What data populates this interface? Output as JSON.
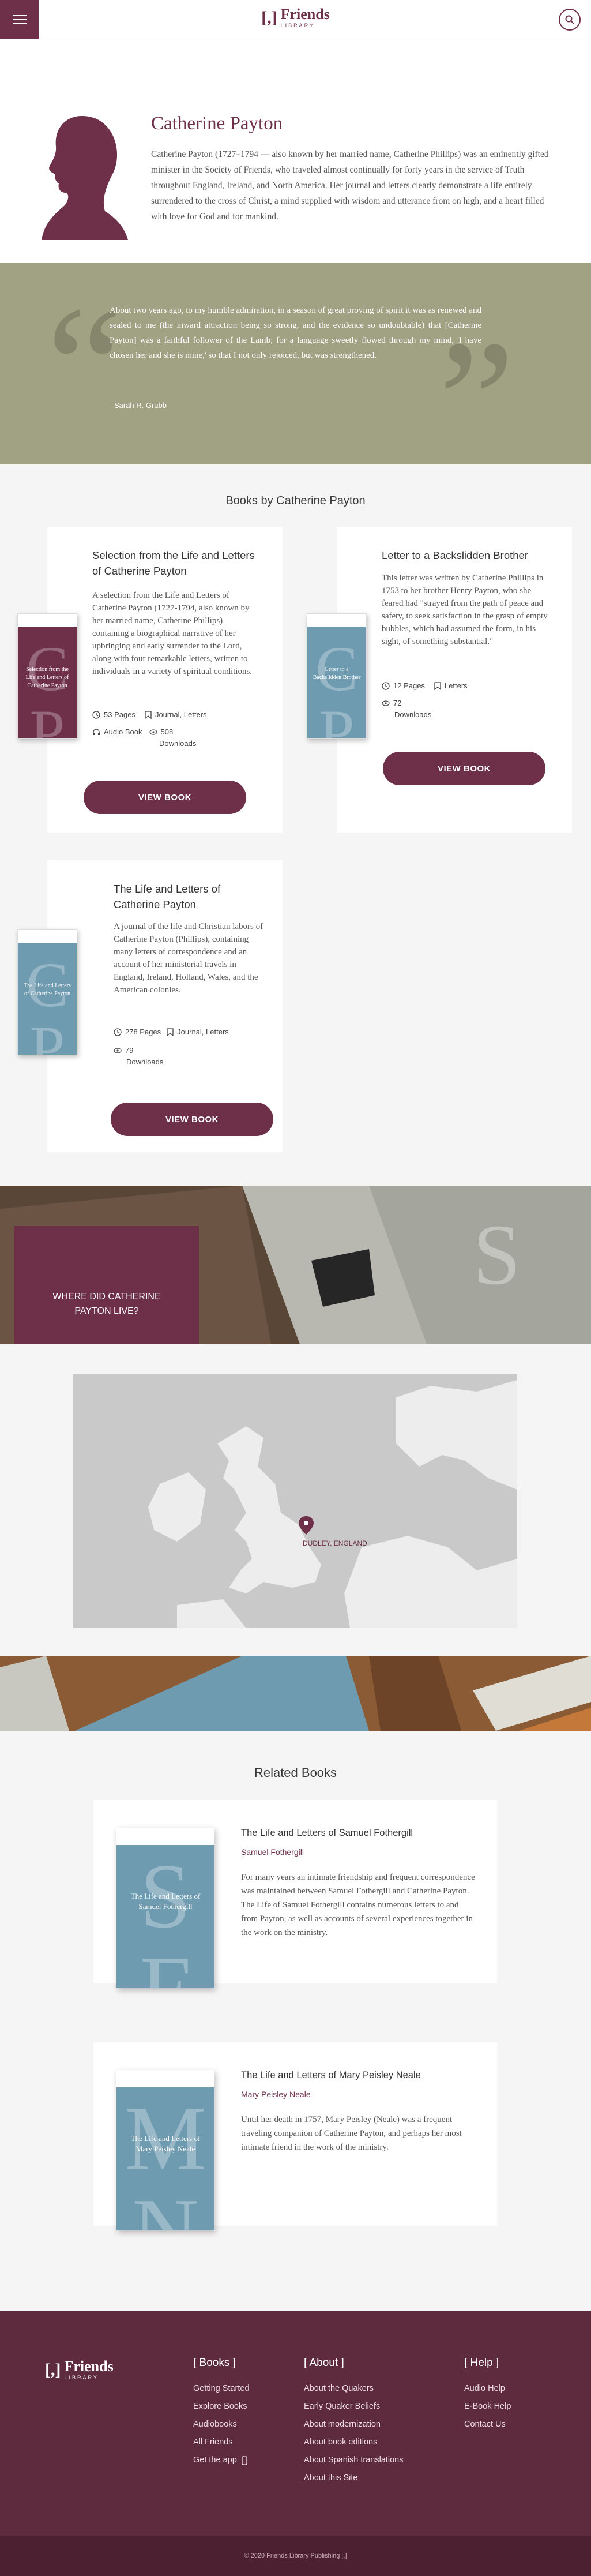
{
  "header": {
    "logo_mark": "[,]",
    "logo_title": "Friends",
    "logo_sub": "LIBRARY"
  },
  "author": {
    "name": "Catherine Payton",
    "bio": "Catherine Payton (1727–1794 — also known by her married name, Catherine Phillips) was an eminently gifted minister in the Society of Friends, who traveled almost continually for forty years in the service of Truth throughout England, Ireland, and North America. Her journal and letters clearly demonstrate a life entirely surrendered to the cross of Christ, a mind supplied with wisdom and utterance from on high, and a heart filled with love for God and for mankind."
  },
  "quote": {
    "text": "About two years ago, to my humble admiration, in a season of great proving of spirit it was as renewed and sealed to me (the inward attraction being so strong, and the evidence so undoubtable) that [Catherine Payton] was a faithful follower of the Lamb; for a language sweetly flowed through my mind, 'I have chosen her and she is mine,' so that I not only rejoiced, but was strengthened.",
    "by": "- Sarah R. Grubb"
  },
  "books_section": {
    "title": "Books by Catherine Payton",
    "view_label": "VIEW BOOK",
    "books": [
      {
        "title": "Selection from the Life and Letters of Catherine Payton",
        "cover_letters": "C P",
        "cover_title": "Selection from the Life and Letters of Catherine Payton",
        "cover_color": "#6e2f48",
        "description": "A selection from the Life and Letters of Catherine Payton (1727-1794, also known by her married name, Catherine Phillips) containing a biographical narrative of her upbringing and early surrender to the Lord, along with four remarkable letters, written to individuals in a variety of spiritual conditions.",
        "pages": "53 Pages",
        "type": "Journal, Letters",
        "audio": "Audio Book",
        "downloads_count": "508",
        "downloads_label": "Downloads"
      },
      {
        "title": "Letter to a Backslidden Brother",
        "cover_letters": "C P",
        "cover_title": "Letter to a Backslidden Brother",
        "cover_color": "#6f9bb0",
        "description": "This letter was written by Catherine Phillips in 1753 to her brother Henry Payton, who she feared had \"strayed from the path of peace and safety, to seek satisfaction in the grasp of empty bubbles, which had assumed the form, in his sight, of something substantial.\"",
        "pages": "12 Pages",
        "type": "Letters",
        "downloads_count": "72",
        "downloads_label": "Downloads"
      },
      {
        "title": "The Life and Letters of Catherine Payton",
        "cover_letters": "C P",
        "cover_title": "The Life and Letters of Catherine Payton",
        "cover_color": "#6f9bb0",
        "description": "A journal of the life and Christian labors of Catherine Payton (Phillips), containing many letters of correspondence and an account of her ministerial travels in England, Ireland, Holland, Wales, and the American colonies.",
        "pages": "278 Pages",
        "type": "Journal, Letters",
        "downloads_count": "79",
        "downloads_label": "Downloads"
      }
    ]
  },
  "where": {
    "title": "WHERE DID CATHERINE PAYTON LIVE?",
    "map_label": "DUDLEY, ENGLAND"
  },
  "related": {
    "title": "Related Books",
    "books": [
      {
        "name": "The Life and Letters of Samuel Fothergill",
        "author": "Samuel Fothergill",
        "letters": "S F",
        "cover_title": "The Life and Letters of Samuel Fothergill",
        "description": "For many years an intimate friendship and frequent correspondence was maintained between Samuel Fothergill and Catherine Payton. The Life of Samuel Fothergill contains numerous letters to and from Payton, as well as accounts of several experiences together in the work on the ministry."
      },
      {
        "name": "The Life and Letters of Mary Peisley Neale",
        "author": "Mary Peisley Neale",
        "letters": "M N",
        "cover_title": "The Life and Letters of Mary Peisley Neale",
        "description": "Until her death in 1757, Mary Peisley (Neale) was a frequent traveling companion of Catherine Payton, and perhaps her most intimate friend in the work of the ministry."
      }
    ]
  },
  "footer": {
    "logo_mark": "[,]",
    "logo_title": "Friends",
    "logo_sub": "LIBRARY",
    "books_head": "[ Books ]",
    "books_links": [
      "Getting Started",
      "Explore Books",
      "Audiobooks",
      "All Friends",
      "Get the app"
    ],
    "about_head": "[ About ]",
    "about_links": [
      "About the Quakers",
      "Early Quaker Beliefs",
      "About modernization",
      "About book editions",
      "About Spanish translations",
      "About this Site"
    ],
    "help_head": "[ Help ]",
    "help_links": [
      "Audio Help",
      "E-Book Help",
      "Contact Us"
    ],
    "copyright": "© 2020 Friends Library Publishing [,]"
  },
  "colors": {
    "brand": "#6e2f48",
    "olive": "#a1a184",
    "cover_blue": "#6f9bb0"
  }
}
